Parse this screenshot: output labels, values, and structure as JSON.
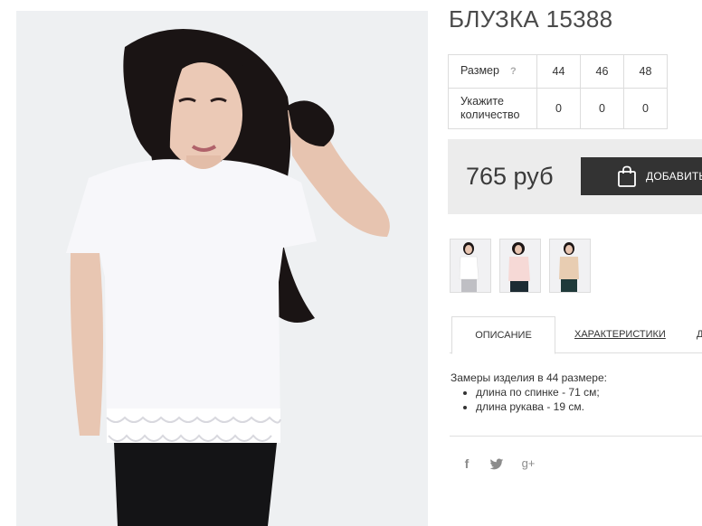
{
  "product": {
    "title": "БЛУЗКА 15388",
    "image_icon": "product-photo-woman-in-white-blouse"
  },
  "sizes": {
    "size_label": "Размер",
    "help_mark": "?",
    "sizes": [
      "44",
      "46",
      "48"
    ],
    "qty_label_1": "Укажите",
    "qty_label_2": "количество",
    "quantities": [
      "0",
      "0",
      "0"
    ]
  },
  "purchase": {
    "price": "765 руб",
    "add_label": "ДОБАВИТЬ",
    "button_color": "#333333",
    "icon": "shopping-bag-icon"
  },
  "thumbnails": [
    "thumbnail-white-blouse",
    "thumbnail-pink-blouse",
    "thumbnail-beige-blouse"
  ],
  "tabs": {
    "description": "ОПИСАНИЕ",
    "characteristics": "ХАРАКТЕРИСТИКИ",
    "more": "Д"
  },
  "description": {
    "intro": "Замеры изделия в 44 размере:",
    "items": [
      "длина по спинке - 71 см;",
      "длина рукава - 19 см."
    ]
  },
  "share": {
    "facebook": "f",
    "twitter": "twitter-icon",
    "google_plus": "g+"
  }
}
